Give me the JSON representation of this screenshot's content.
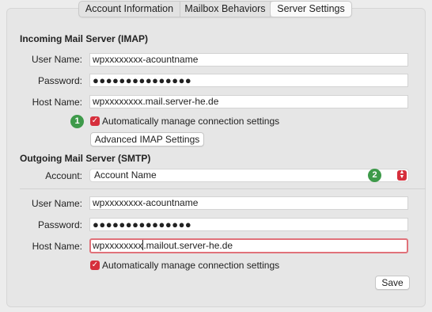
{
  "tabs": [
    {
      "label": "Account Information"
    },
    {
      "label": "Mailbox Behaviors"
    },
    {
      "label": "Server Settings"
    }
  ],
  "incoming": {
    "title": "Incoming Mail Server (IMAP)",
    "user_label": "User Name:",
    "user_value": "wpxxxxxxxx-acountname",
    "password_label": "Password:",
    "password_value": "●●●●●●●●●●●●●●●",
    "host_label": "Host Name:",
    "host_value": "wpxxxxxxxx.mail.server-he.de",
    "auto_label": "Automatically manage connection settings",
    "auto_checked": true,
    "advanced_button": "Advanced IMAP Settings",
    "badge": "1"
  },
  "outgoing": {
    "title": "Outgoing Mail Server (SMTP)",
    "account_label": "Account:",
    "account_value": "Account Name",
    "badge": "2",
    "user_label": "User Name:",
    "user_value": "wpxxxxxxxx-acountname",
    "password_label": "Password:",
    "password_value": "●●●●●●●●●●●●●●●",
    "host_label": "Host Name:",
    "host_value_before_caret": "wpxxxxxxxx",
    "host_value_after_caret": ".mailout.server-he.de",
    "auto_label": "Automatically manage connection settings",
    "auto_checked": true
  },
  "save_button": "Save",
  "colors": {
    "accent": "#d62f3c",
    "badge_green": "#3e9a4a",
    "focus_ring": "#e0727a"
  }
}
